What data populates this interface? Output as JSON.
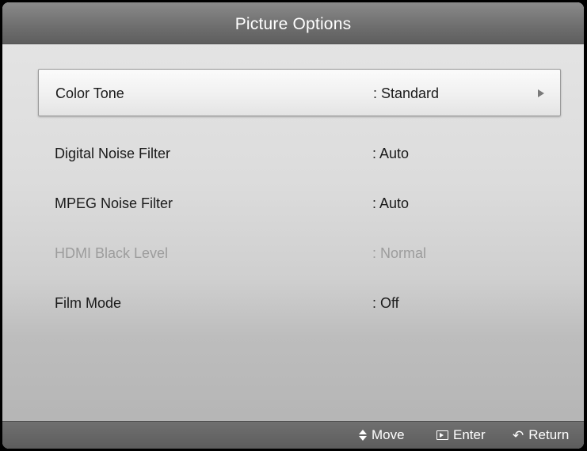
{
  "menu": {
    "title": "Picture Options",
    "items": [
      {
        "label": "Color Tone",
        "value": ": Standard",
        "selected": true,
        "enabled": true
      },
      {
        "label": "Digital Noise Filter",
        "value": ": Auto",
        "selected": false,
        "enabled": true
      },
      {
        "label": "MPEG Noise Filter",
        "value": ": Auto",
        "selected": false,
        "enabled": true
      },
      {
        "label": "HDMI Black Level",
        "value": ": Normal",
        "selected": false,
        "enabled": false
      },
      {
        "label": "Film Mode",
        "value": ": Off",
        "selected": false,
        "enabled": true
      }
    ]
  },
  "footer": {
    "move_label": "Move",
    "enter_label": "Enter",
    "return_label": "Return"
  },
  "icons": {
    "submenu_arrow": "chevron-right-icon",
    "move": "up-down-arrows-icon",
    "enter": "enter-icon",
    "return": "return-icon"
  },
  "colors": {
    "title_bar": "#707070",
    "menu_background": "#dcdcdc",
    "selected_row": "#f0f0f0",
    "disabled_text": "#9c9c9c"
  }
}
